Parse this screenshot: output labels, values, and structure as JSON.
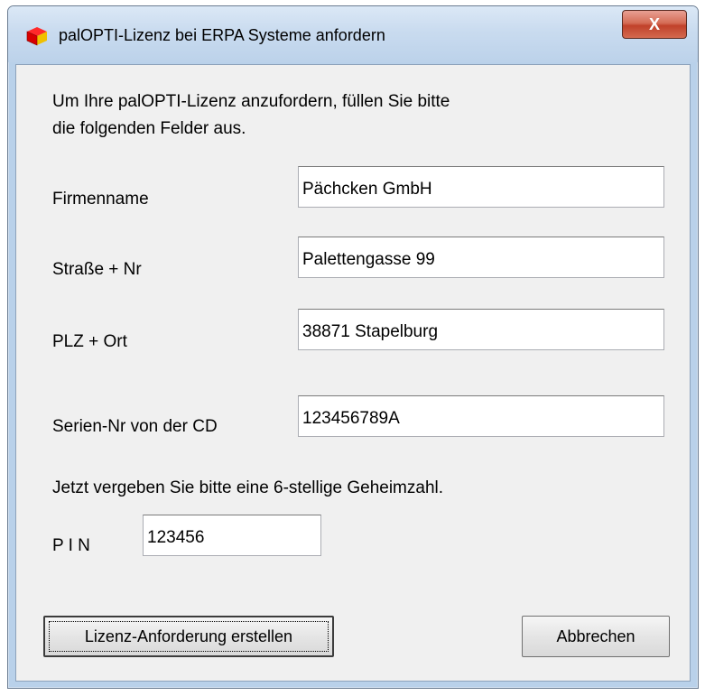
{
  "window": {
    "title": "palOPTI-Lizenz bei ERPA Systeme anfordern",
    "close_label": "X"
  },
  "intro": {
    "line1": "Um Ihre palOPTI-Lizenz anzufordern, füllen Sie bitte",
    "line2": "die folgenden Felder aus."
  },
  "fields": {
    "firmenname": {
      "label": "Firmenname",
      "value": "Pächcken GmbH"
    },
    "strasse": {
      "label": "Straße + Nr",
      "value": "Palettengasse 99"
    },
    "plz_ort": {
      "label": "PLZ + Ort",
      "value": "38871 Stapelburg"
    },
    "serien_nr": {
      "label": "Serien-Nr von der CD",
      "value": "123456789A"
    }
  },
  "pin_prompt": "Jetzt vergeben Sie bitte eine 6-stellige Geheimzahl.",
  "pin": {
    "label": "P I N",
    "value": "123456"
  },
  "buttons": {
    "create": "Lizenz-Anforderung erstellen",
    "cancel": "Abbrechen"
  }
}
